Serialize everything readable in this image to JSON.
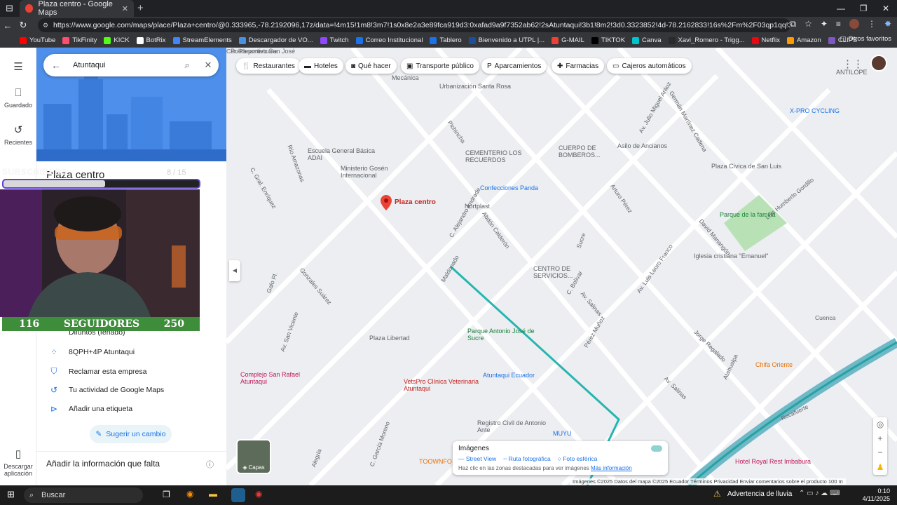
{
  "browser": {
    "tab_title": "Plaza centro - Google Maps",
    "url": "https://www.google.com/maps/place/Plaza+centro/@0.333965,-78.2192096,17z/data=!4m15!1m8!3m7!1s0x8e2a3e89fca919d3:0xafad9a9f7352ab62!2sAtuntaqui!3b1!8m2!3d0.3323852!4d-78.2162833!16s%2Fm%2F03qp1qq!3m5!1s0x8e2a3f0...",
    "bookmarks": [
      "YouTube",
      "TikFinity",
      "KICK",
      "BotRix",
      "StreamElements",
      "Descargador de VO...",
      "Twitch",
      "Correo Institucional",
      "Tablero",
      "Bienvenido a UTPL |...",
      "G-MAIL",
      "TIKTOK",
      "Canva",
      "Xavi_Romero - Trigg...",
      "Netflix",
      "Amazon",
      "CLIPS"
    ],
    "bookmark_colors": [
      "#ff0000",
      "#ff4d6d",
      "#53fc18",
      "#ffffff",
      "#4285f4",
      "#4a90e2",
      "#9146ff",
      "#1a73e8",
      "#1a73e8",
      "#1b4f9c",
      "#ea4335",
      "#000000",
      "#00c4cc",
      "#2a2a2a",
      "#e50914",
      "#ff9900",
      "#7e57c2"
    ],
    "other_favorites": "Otros favoritos"
  },
  "rail": {
    "saved": "Guardado",
    "recent": "Recientes",
    "download": "Descargar aplicación"
  },
  "search": {
    "value": "Atuntaqui"
  },
  "place": {
    "title": "Plaza centro",
    "holiday": "Difuntos (feriado)",
    "plus_code": "8QPH+4P Atuntaqui",
    "claim": "Reclamar esta empresa",
    "activity": "Tu actividad de Google Maps",
    "label": "Añadir una etiqueta",
    "suggest": "Sugerir un cambio",
    "missing": "Añadir la información que falta"
  },
  "overlay": {
    "subs_label": "SUBSCRIBERS",
    "subs_count": "8 / 15",
    "subs_progress": 0.52,
    "followers_current": "116",
    "followers_label": "SEGUIDORES",
    "followers_goal": "250"
  },
  "chips": [
    {
      "label": "Restaurantes",
      "icon": "fork-knife-icon"
    },
    {
      "label": "Hoteles",
      "icon": "bed-icon"
    },
    {
      "label": "Qué hacer",
      "icon": "camera-icon"
    },
    {
      "label": "Transporte público",
      "icon": "bus-icon"
    },
    {
      "label": "Aparcamientos",
      "icon": "parking-icon"
    },
    {
      "label": "Farmacias",
      "icon": "pharmacy-icon"
    },
    {
      "label": "Cajeros automáticos",
      "icon": "atm-icon"
    }
  ],
  "map": {
    "place_label": "Plaza centro",
    "labels": [
      "Polideportivo San José",
      "Mecánica",
      "Urbanización Santa Rosa",
      "Escuela General Básica ADAI",
      "Ministerio Gosén Internacional",
      "CEMENTERIO LOS RECUERDOS",
      "CUERPO DE BOMBEROS...",
      "Asilo de Ancianos",
      "X-PRO CYCLING",
      "Confecciones Panda",
      "Nortplast",
      "Plaza Cívica de San Luis",
      "Parque de la familia",
      "CENTRO DE SERVICIOS...",
      "Iglesia cristiana \"Emanuel\"",
      "Parque Antonio José de Sucre",
      "Plaza Libertad",
      "Atuntaqui Ecuador",
      "VetsPro Clínica Veterinaria Atuntaqui",
      "Complejo San Rafael Atuntaqui",
      "Registro Civil de Antonio Ante",
      "Chifa Oriente",
      "Hotel Royal Rest Imbabura",
      "ANTILOPE",
      "MUYU",
      "TOOWNFO"
    ],
    "streets": [
      "Río Amazonas",
      "Pichincha",
      "Maldonado",
      "C. Gral. Enríquez",
      "C. Alejandro Andrade",
      "Abdón Calderón",
      "Arturo Pérez",
      "Av. Luis Leoro Franco",
      "Luis Humberto Gordillo",
      "David Manangón",
      "Sucre",
      "C. Bolívar",
      "Av. Salinas",
      "Av. Julio Miguel Aráuz",
      "Germán Martínez Cadena",
      "Av. San Vicente",
      "Gonzales Suárez",
      "Galo Pl.",
      "C. García Moreno",
      "Jorge Regalado",
      "Atahualpa",
      "Av. Salinas",
      "Cuenca",
      "Pérez Muñoz",
      "Alegría",
      "Rocafuerte",
      "Car.-Panamericana"
    ],
    "layers_label": "Capas",
    "images_box": {
      "title": "Imágenes",
      "legend": [
        "Street View",
        "Ruta fotográfica",
        "Foto esférica"
      ],
      "hint": "Haz clic en las zonas destacadas para ver imágenes",
      "more": "Más información"
    },
    "footer": "Imágenes ©2025  Datos del mapa ©2025    Ecuador    Términos    Privacidad    Enviar comentarios sobre el producto    100 m"
  },
  "taskbar": {
    "search": "Buscar",
    "weather": "Advertencia de lluvia",
    "time": "0:10",
    "date": "4/11/2025"
  }
}
